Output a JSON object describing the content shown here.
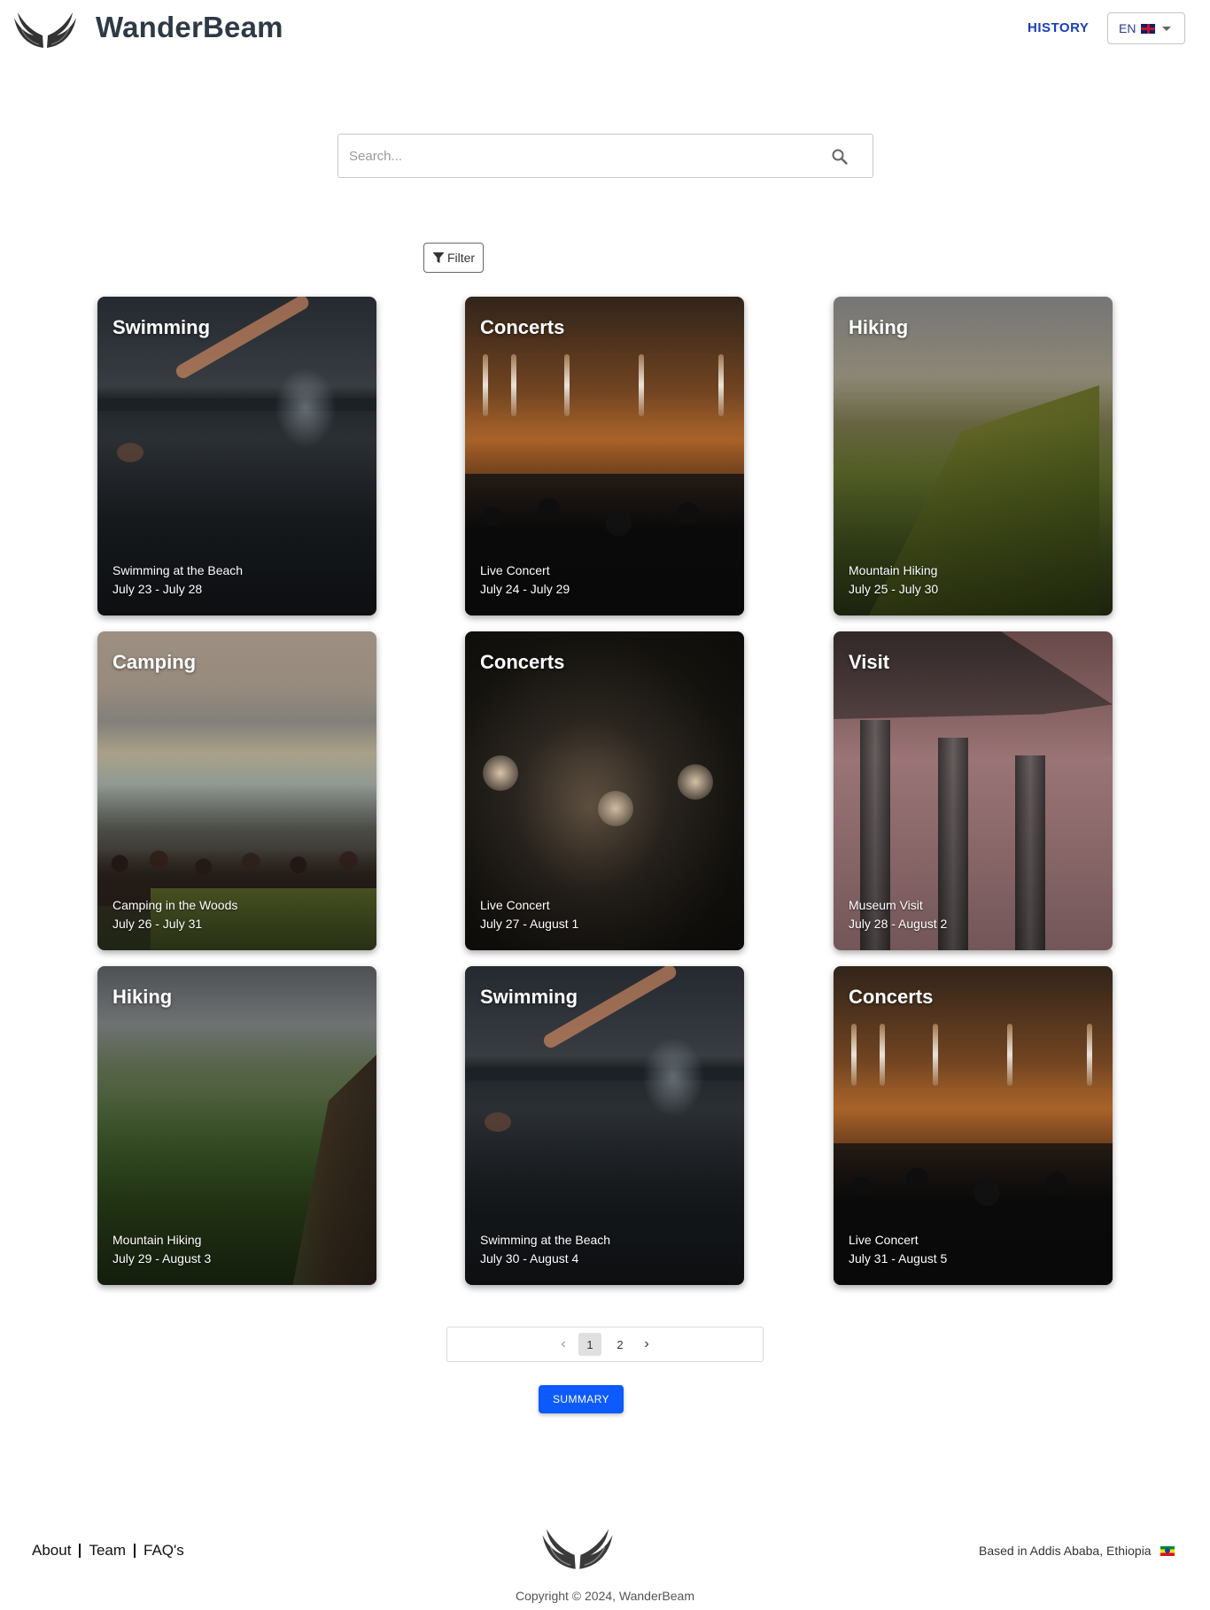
{
  "header": {
    "brand": "WanderBeam",
    "history_label": "HISTORY",
    "language": {
      "code": "EN",
      "flag": "uk-flag-icon"
    }
  },
  "search": {
    "placeholder": "Search...",
    "value": "",
    "icon": "search-icon"
  },
  "filter": {
    "label": "Filter",
    "icon": "filter-icon"
  },
  "cards": [
    {
      "category": "Swimming",
      "title": "Swimming at the Beach",
      "dates": "July 23 - July 28"
    },
    {
      "category": "Concerts",
      "title": "Live Concert",
      "dates": "July 24 - July 29"
    },
    {
      "category": "Hiking",
      "title": "Mountain Hiking",
      "dates": "July 25 - July 30"
    },
    {
      "category": "Camping",
      "title": "Camping in the Woods",
      "dates": "July 26 - July 31"
    },
    {
      "category": "Concerts",
      "title": "Live Concert",
      "dates": "July 27 - August 1"
    },
    {
      "category": "Visit",
      "title": "Museum Visit",
      "dates": "July 28 - August 2"
    },
    {
      "category": "Hiking",
      "title": "Mountain Hiking",
      "dates": "July 29 - August 3"
    },
    {
      "category": "Swimming",
      "title": "Swimming at the Beach",
      "dates": "July 30 - August 4"
    },
    {
      "category": "Concerts",
      "title": "Live Concert",
      "dates": "July 31 - August 5"
    }
  ],
  "pagination": {
    "pages": [
      "1",
      "2"
    ],
    "current": "1",
    "prev_icon": "chevron-left-icon",
    "next_icon": "chevron-right-icon"
  },
  "summary_label": "SUMMARY",
  "footer": {
    "links": [
      "About",
      "Team",
      "FAQ's"
    ],
    "location": "Based in Addis Ababa, Ethiopia",
    "location_flag": "ethiopia-flag-icon",
    "copyright": "Copyright © 2024, WanderBeam"
  },
  "colors": {
    "brand_text": "#2d3a45",
    "history_link": "#1a3fb8",
    "summary_button": "#0d5bff"
  }
}
